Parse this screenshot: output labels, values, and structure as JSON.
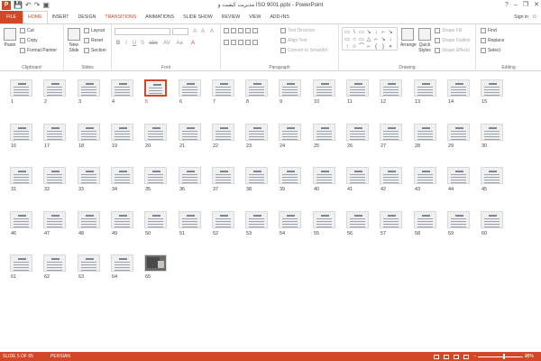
{
  "window": {
    "title": "مدیریت کیفیت و ISO 9001.pptx - PowerPoint",
    "minimize": "–",
    "restore": "❐",
    "close": "✕",
    "help": "?"
  },
  "qat": {
    "app_icon": "P",
    "save": "💾",
    "undo": "↶",
    "redo": "↷",
    "present": "▣"
  },
  "tabs": {
    "file": "FILE",
    "home": "HOME",
    "insert": "INSERT",
    "design": "DESIGN",
    "transitions": "TRANSITIONS",
    "animations": "ANIMATIONS",
    "slideshow": "SLIDE SHOW",
    "review": "REVIEW",
    "view": "VIEW",
    "addins": "ADD-INS",
    "signin": "Sign in"
  },
  "ribbon": {
    "clipboard": {
      "label": "Clipboard",
      "paste": "Paste",
      "cut": "Cut",
      "copy": "Copy",
      "format_painter": "Format Painter"
    },
    "slides": {
      "label": "Slides",
      "new_slide": "New Slide",
      "layout": "Layout",
      "reset": "Reset",
      "section": "Section"
    },
    "font": {
      "label": "Font",
      "size_up": "A",
      "size_down": "A",
      "clear": "A",
      "bold": "B",
      "italic": "I",
      "underline": "U",
      "shadow": "S",
      "strike": "abc",
      "spacing": "AV",
      "case": "Aa",
      "color": "A"
    },
    "paragraph": {
      "label": "Paragraph",
      "text_direction": "Text Direction",
      "align_text": "Align Text",
      "convert_smartart": "Convert to SmartArt"
    },
    "drawing": {
      "label": "Drawing",
      "arrange": "Arrange",
      "quick_styles": "Quick Styles",
      "shape_fill": "Shape Fill",
      "shape_outline": "Shape Outline",
      "shape_effects": "Shape Effects",
      "shapes": [
        "▭",
        "\\",
        "▭",
        "↘",
        "↓",
        "⌐",
        "↘",
        "▭",
        "○",
        "▭",
        "△",
        "⌐",
        "↘",
        "↓",
        "↑",
        "☆",
        "⌒",
        "⌐",
        "{",
        "}",
        "⋄"
      ]
    },
    "editing": {
      "label": "Editing",
      "find": "Find",
      "replace": "Replace",
      "select": "Select"
    }
  },
  "slides": {
    "count": 65,
    "selected": 5,
    "numbers": [
      "1",
      "2",
      "3",
      "4",
      "5",
      "6",
      "7",
      "8",
      "9",
      "10",
      "11",
      "12",
      "13",
      "14",
      "15",
      "16",
      "17",
      "18",
      "19",
      "20",
      "21",
      "22",
      "23",
      "24",
      "25",
      "26",
      "27",
      "28",
      "29",
      "30",
      "31",
      "32",
      "33",
      "34",
      "35",
      "36",
      "37",
      "38",
      "39",
      "40",
      "41",
      "42",
      "43",
      "44",
      "45",
      "46",
      "47",
      "48",
      "49",
      "50",
      "51",
      "52",
      "53",
      "54",
      "55",
      "56",
      "57",
      "58",
      "59",
      "60",
      "61",
      "62",
      "63",
      "64",
      "65"
    ]
  },
  "statusbar": {
    "slide_info": "SLIDE 5 OF 65",
    "language": "PERSIAN",
    "zoom": "28%",
    "zoom_minus": "–",
    "zoom_plus": "+"
  },
  "colors": {
    "accent": "#d24726",
    "statusbar": "#d24726"
  }
}
